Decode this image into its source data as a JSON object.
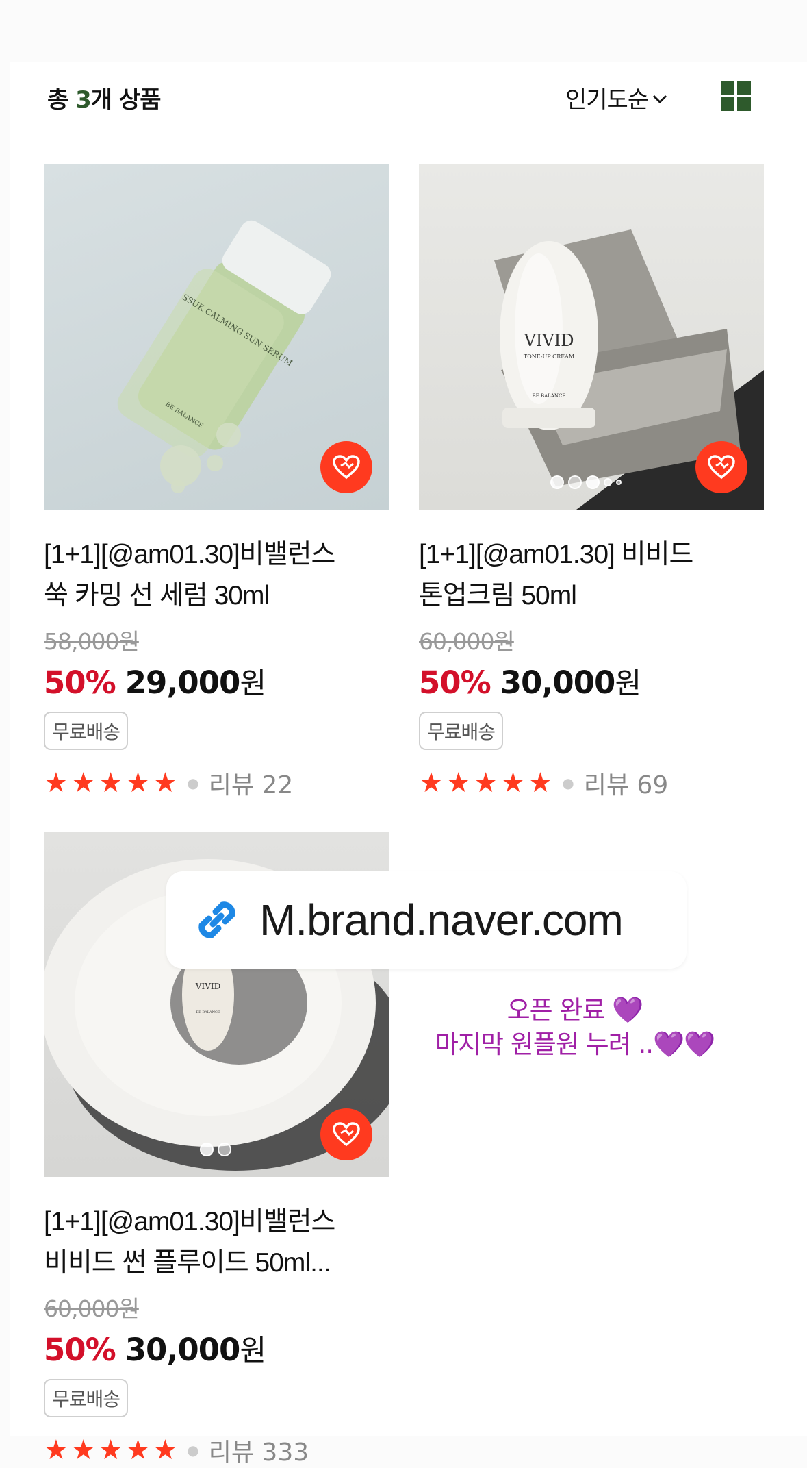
{
  "header": {
    "count_prefix": "총 ",
    "count_number": "3",
    "count_suffix": "개 상품",
    "sort_label": "인기도순",
    "layout_icon": "grid-view-icon"
  },
  "products": [
    {
      "title_line1": "[1+1][@am01.30]비밸런스",
      "title_line2": "쑥 카밍 선 세럼 30ml",
      "original_price": "58,000원",
      "discount": "50%",
      "price": "29,000",
      "currency": "원",
      "badge": "무료배송",
      "rating": 5,
      "review_label": "리뷰 22",
      "product_text": "SSUK CALMING SUN SERUM",
      "brand_text": "BE BALANCE"
    },
    {
      "title_line1": "[1+1][@am01.30] 비비드",
      "title_line2": "톤업크림 50ml",
      "original_price": "60,000원",
      "discount": "50%",
      "price": "30,000",
      "currency": "원",
      "badge": "무료배송",
      "rating": 5,
      "review_label": "리뷰 69",
      "product_text": "VIVID",
      "product_subtext": "TONE-UP CREAM",
      "brand_text": "BE BALANCE"
    },
    {
      "title_line1": "[1+1][@am01.30]비밸런스",
      "title_line2": "비비드 썬 플루이드 50ml...",
      "original_price": "60,000원",
      "discount": "50%",
      "price": "30,000",
      "currency": "원",
      "badge": "무료배송",
      "rating": 5,
      "review_label": "리뷰 333",
      "product_text": "VIVID",
      "brand_text": "BE BALANCE"
    }
  ],
  "link_sticker": {
    "icon": "link-icon",
    "url": "M.brand.naver.com"
  },
  "note": {
    "line1": "오픈 완료 💜",
    "line2": "마지막 원플원 누려 ..💜💜"
  },
  "colors": {
    "accent_green": "#2e5a2c",
    "heart_red": "#ff3a1f",
    "discount_red": "#d3102a",
    "note_purple": "#a020a6"
  }
}
